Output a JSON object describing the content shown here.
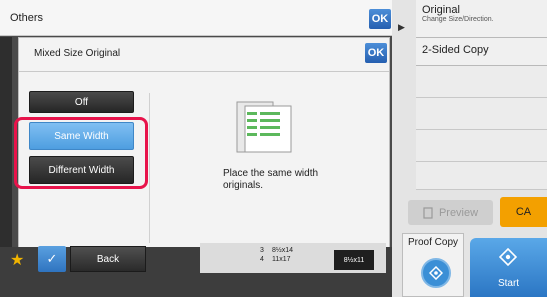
{
  "others": {
    "title": "Others",
    "ok_label": "OK"
  },
  "dialog": {
    "title": "Mixed Size Original",
    "ok_label": "OK",
    "options": {
      "off": "Off",
      "same_width": "Same Width",
      "different_width": "Different Width"
    },
    "selected": "same_width",
    "description": "Place the same width originals."
  },
  "right_panel": {
    "original_title": "Original",
    "original_sub": "Change Size/Direction.",
    "two_sided": "2-Sided Copy",
    "preview_label": "Preview",
    "ca_label": "CA",
    "proof_copy_label": "Proof Copy",
    "start_label": "Start"
  },
  "bottom": {
    "back_label": "Back",
    "tray_3_num": "3",
    "tray_3_size": "8½x14",
    "tray_4_num": "4",
    "tray_4_size": "11x17",
    "tray_selected_size": "8½x11"
  },
  "colors": {
    "ok_blue": "#255fb0",
    "selected_blue": "#4e9ee0",
    "highlight_red": "#e8134b",
    "ca_orange": "#f3a000",
    "star": "#f1b400"
  },
  "icons": [
    "star-icon",
    "check-icon",
    "proof-copy-icon",
    "start-icon",
    "preview-icon",
    "same-width-originals-icon"
  ]
}
